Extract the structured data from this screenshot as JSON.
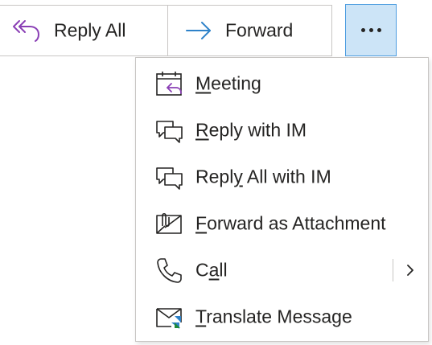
{
  "toolbar": {
    "reply_all": {
      "label": "Reply All",
      "icon": "reply-all-icon",
      "icon_color": "#8a3fb5"
    },
    "forward": {
      "label": "Forward",
      "icon": "forward-arrow-icon",
      "icon_color": "#2e82c9"
    },
    "more": {
      "icon": "more-dots-icon",
      "state": "active",
      "bg_color": "#cce4f7",
      "border_color": "#4d9de0"
    }
  },
  "menu": {
    "items": [
      {
        "label_pre": "",
        "label_key": "M",
        "label_post": "eeting",
        "icon": "meeting-calendar-icon",
        "has_submenu": false
      },
      {
        "label_pre": "",
        "label_key": "R",
        "label_post": "eply with IM",
        "icon": "chat-bubbles-icon",
        "has_submenu": false
      },
      {
        "label_pre": "Repl",
        "label_key": "y",
        "label_post": " All with IM",
        "icon": "chat-bubbles-icon",
        "has_submenu": false
      },
      {
        "label_pre": "",
        "label_key": "F",
        "label_post": "orward as Attachment",
        "icon": "envelope-paperclip-icon",
        "has_submenu": false
      },
      {
        "label_pre": "C",
        "label_key": "a",
        "label_post": "ll",
        "icon": "phone-icon",
        "has_submenu": true
      },
      {
        "label_pre": "",
        "label_key": "T",
        "label_post": "ranslate Message",
        "icon": "translate-envelope-icon",
        "has_submenu": false
      }
    ]
  }
}
